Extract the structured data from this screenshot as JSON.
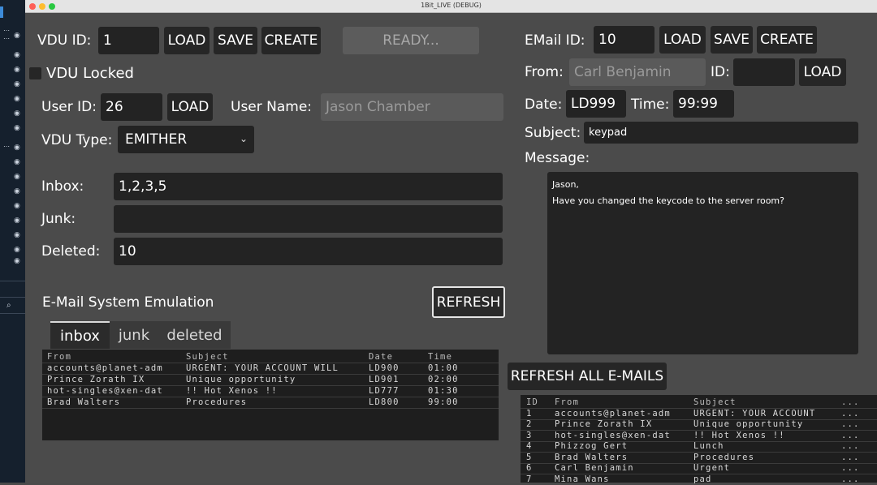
{
  "window": {
    "title": "1Bit_LIVE (DEBUG)"
  },
  "vdu": {
    "id_label": "VDU ID:",
    "id_value": "1",
    "load": "LOAD",
    "save": "SAVE",
    "create": "CREATE",
    "status": "READY...",
    "locked_label": "VDU Locked",
    "user_id_label": "User ID:",
    "user_id_value": "26",
    "user_load": "LOAD",
    "user_name_label": "User Name:",
    "user_name_value": "Jason Chamber",
    "type_label": "VDU Type:",
    "type_value": "EMITHER",
    "inbox_label": "Inbox:",
    "inbox_value": "1,2,3,5",
    "junk_label": "Junk:",
    "junk_value": "",
    "deleted_label": "Deleted:",
    "deleted_value": "10"
  },
  "emulation": {
    "title": "E-Mail System Emulation",
    "refresh": "REFRESH",
    "tabs": [
      {
        "label": "inbox",
        "active": true
      },
      {
        "label": "junk",
        "active": false
      },
      {
        "label": "deleted",
        "active": false
      }
    ],
    "headers": {
      "from": "From",
      "subject": "Subject",
      "date": "Date",
      "time": "Time"
    },
    "rows": [
      {
        "from": "accounts@planet-adm",
        "subject": "URGENT: YOUR ACCOUNT WILL",
        "date": "LD900",
        "time": "01:00"
      },
      {
        "from": "Prince Zorath IX",
        "subject": "Unique opportunity",
        "date": "LD901",
        "time": "02:00"
      },
      {
        "from": "hot-singles@xen-dat",
        "subject": "!! Hot Xenos !!",
        "date": "LD777",
        "time": "01:30"
      },
      {
        "from": "Brad Walters",
        "subject": "Procedures",
        "date": "LD800",
        "time": "99:00"
      }
    ]
  },
  "email": {
    "id_label": "EMail ID:",
    "id_value": "10",
    "load": "LOAD",
    "save": "SAVE",
    "create": "CREATE",
    "from_label": "From:",
    "from_value": "Carl Benjamin",
    "from_id_label": "ID:",
    "from_id_value": "",
    "from_load": "LOAD",
    "date_label": "Date:",
    "date_value": "LD999",
    "time_label": "Time:",
    "time_value": "99:99",
    "subject_label": "Subject:",
    "subject_value": "keypad",
    "message_label": "Message:",
    "message_line1": "Jason,",
    "message_line2": "Have you changed the keycode to the server room?"
  },
  "all_emails": {
    "refresh_all": "REFRESH ALL E-MAILS",
    "headers": {
      "id": "ID",
      "from": "From",
      "subject": "Subject",
      "more": "..."
    },
    "rows": [
      {
        "id": "1",
        "from": "accounts@planet-adm",
        "subject": "URGENT: YOUR ACCOUNT",
        "more": "..."
      },
      {
        "id": "2",
        "from": "Prince Zorath IX",
        "subject": "Unique opportunity",
        "more": "..."
      },
      {
        "id": "3",
        "from": "hot-singles@xen-dat",
        "subject": "!! Hot Xenos !!",
        "more": "..."
      },
      {
        "id": "4",
        "from": "Phizzog Gert",
        "subject": "Lunch",
        "more": "..."
      },
      {
        "id": "5",
        "from": "Brad Walters",
        "subject": "Procedures",
        "more": "..."
      },
      {
        "id": "6",
        "from": "Carl Benjamin",
        "subject": "Urgent",
        "more": "..."
      },
      {
        "id": "7",
        "from": "Mina Wans",
        "subject": "pad",
        "more": "..."
      }
    ]
  }
}
